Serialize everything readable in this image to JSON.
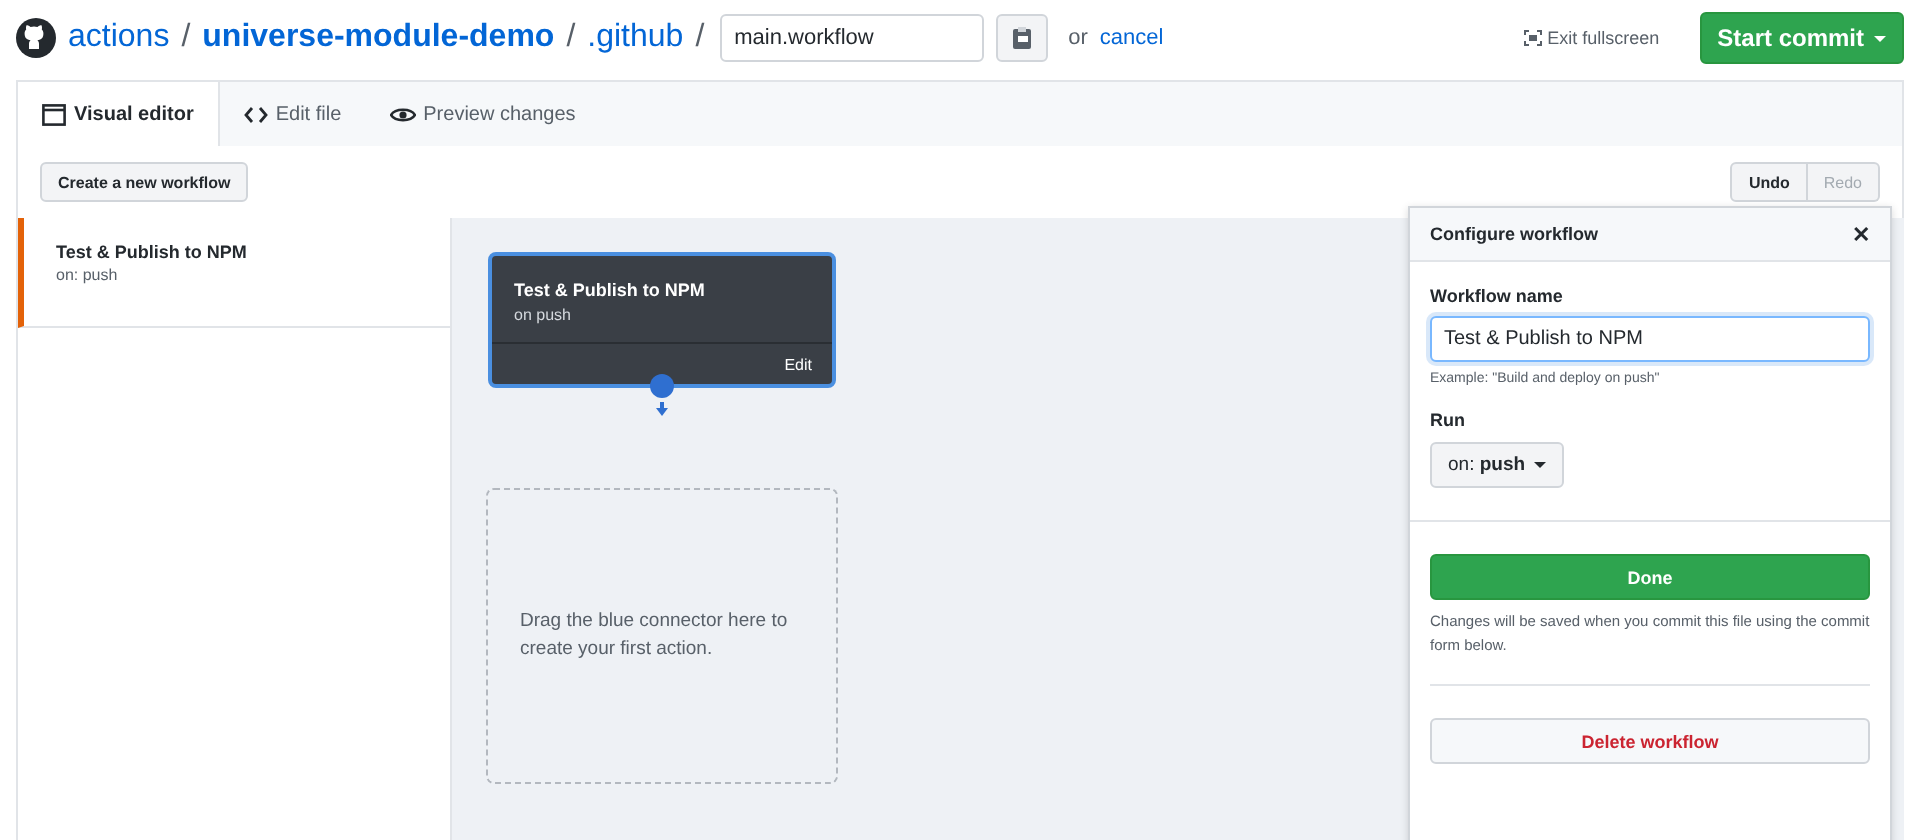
{
  "header": {
    "breadcrumb": [
      {
        "text": "actions",
        "kind": "link"
      },
      {
        "text": "/",
        "kind": "sep"
      },
      {
        "text": "universe-module-demo",
        "kind": "repo"
      },
      {
        "text": "/",
        "kind": "sep"
      },
      {
        "text": ".github",
        "kind": "link"
      },
      {
        "text": "/",
        "kind": "sep"
      }
    ],
    "filename": "main.workflow",
    "or_text": "or",
    "cancel": "cancel",
    "exit_fullscreen": "Exit fullscreen",
    "commit_button": "Start commit"
  },
  "tabs": [
    {
      "label": "Visual editor",
      "selected": true
    },
    {
      "label": "Edit file",
      "selected": false
    },
    {
      "label": "Preview changes",
      "selected": false
    }
  ],
  "toolbar": {
    "create_button": "Create a new workflow",
    "undo": {
      "label": "Undo",
      "disabled": false
    },
    "redo": {
      "label": "Redo",
      "disabled": true
    }
  },
  "sidebar": {
    "items": [
      {
        "title": "Test & Publish to NPM",
        "subtitle": "on: push",
        "selected": true
      }
    ]
  },
  "canvas": {
    "workflow_node": {
      "title": "Test & Publish to NPM",
      "subtitle": "on push",
      "edit": "Edit",
      "selected": true
    },
    "drop_zone": "Drag the blue connector here to create your first action."
  },
  "panel": {
    "title": "Configure workflow",
    "close": "✕",
    "name_label": "Workflow name",
    "name_value": "Test & Publish to NPM",
    "hint": "Example: \"Build and deploy on push\"",
    "run_label": "Run",
    "run_button": "on: **push**",
    "done": "Done",
    "note": "Changes will be saved when you commit this file using the commit form below.",
    "delete": "Delete workflow"
  }
}
